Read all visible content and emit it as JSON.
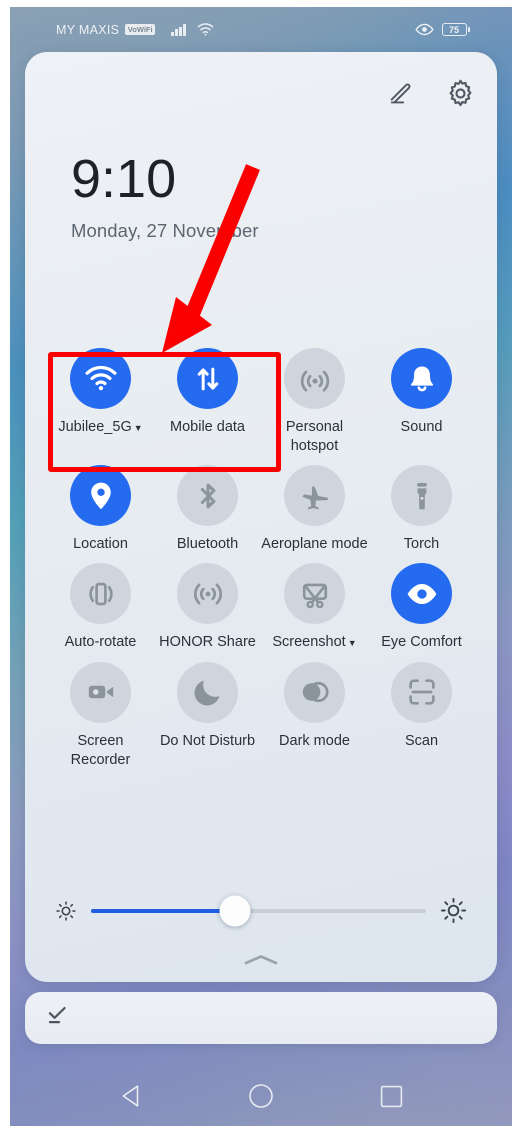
{
  "status_bar": {
    "carrier": "MY MAXIS",
    "vowifi_badge": "VoWiFi",
    "signal_icon": "signal-bars-icon",
    "wifi_icon": "wifi-icon",
    "eye_icon": "eye-comfort-status-icon",
    "battery_level": "75"
  },
  "panel": {
    "edit_icon": "pencil-edit-icon",
    "settings_icon": "gear-settings-icon",
    "clock_time": "9:10",
    "clock_date": "Monday, 27 November",
    "collapse_icon": "chevron-up-icon"
  },
  "toggles": [
    {
      "id": "wifi",
      "label": "Jubilee_5G",
      "icon": "wifi-icon",
      "state": "on",
      "has_caret": true
    },
    {
      "id": "mobile-data",
      "label": "Mobile data",
      "icon": "mobile-data-icon",
      "state": "on",
      "has_caret": false
    },
    {
      "id": "personal-hotspot",
      "label": "Personal hotspot",
      "icon": "hotspot-icon",
      "state": "off",
      "has_caret": false
    },
    {
      "id": "sound",
      "label": "Sound",
      "icon": "bell-sound-icon",
      "state": "on",
      "has_caret": false
    },
    {
      "id": "location",
      "label": "Location",
      "icon": "location-pin-icon",
      "state": "on",
      "has_caret": false
    },
    {
      "id": "bluetooth",
      "label": "Bluetooth",
      "icon": "bluetooth-icon",
      "state": "off",
      "has_caret": false
    },
    {
      "id": "aeroplane-mode",
      "label": "Aeroplane mode",
      "icon": "aeroplane-icon",
      "state": "off",
      "has_caret": false
    },
    {
      "id": "torch",
      "label": "Torch",
      "icon": "torch-icon",
      "state": "off",
      "has_caret": false
    },
    {
      "id": "auto-rotate",
      "label": "Auto-rotate",
      "icon": "auto-rotate-icon",
      "state": "off",
      "has_caret": false
    },
    {
      "id": "honor-share",
      "label": "HONOR Share",
      "icon": "honor-share-icon",
      "state": "off",
      "has_caret": false
    },
    {
      "id": "screenshot",
      "label": "Screenshot",
      "icon": "screenshot-icon",
      "state": "off",
      "has_caret": true
    },
    {
      "id": "eye-comfort",
      "label": "Eye Comfort",
      "icon": "eye-icon",
      "state": "on",
      "has_caret": false
    },
    {
      "id": "screen-recorder",
      "label": "Screen Recorder",
      "icon": "video-camera-icon",
      "state": "off",
      "has_caret": false
    },
    {
      "id": "do-not-disturb",
      "label": "Do Not Disturb",
      "icon": "moon-icon",
      "state": "off",
      "has_caret": false
    },
    {
      "id": "dark-mode",
      "label": "Dark mode",
      "icon": "dark-mode-icon",
      "state": "off",
      "has_caret": false
    },
    {
      "id": "scan",
      "label": "Scan",
      "icon": "scan-frame-icon",
      "state": "off",
      "has_caret": false
    }
  ],
  "brightness": {
    "low_icon": "brightness-low-icon",
    "high_icon": "brightness-high-icon",
    "value_percent": 43
  },
  "notifications": {
    "clear_all_icon": "clear-all-notifications-icon"
  },
  "navbar": {
    "back_icon": "back-triangle-icon",
    "home_icon": "home-circle-icon",
    "recents_icon": "recents-square-icon"
  },
  "annotations": {
    "highlight_box_color": "#fb0000",
    "arrow_color": "#fb0000"
  },
  "colors": {
    "toggle_on": "#246bf0",
    "toggle_off": "#cfd5dc",
    "slider_fill": "#1f5fe0",
    "panel_bg": "#eef1f5"
  }
}
